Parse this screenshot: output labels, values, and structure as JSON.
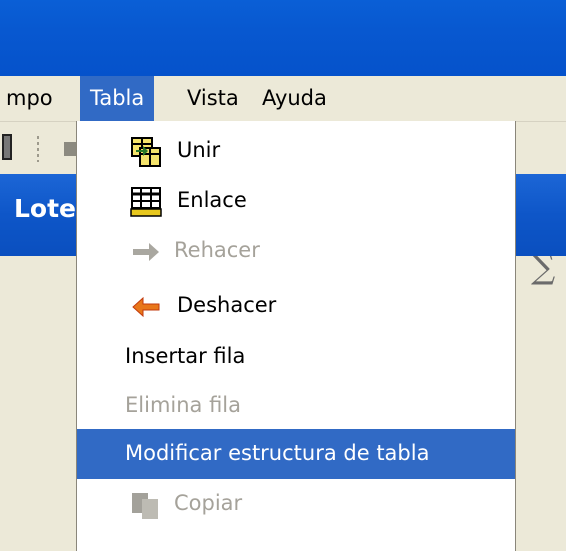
{
  "menubar": {
    "items": [
      {
        "label": "mpo"
      },
      {
        "label": "Tabla",
        "active": true
      },
      {
        "label": "Vista"
      },
      {
        "label": "Ayuda"
      }
    ]
  },
  "toolbar": {
    "sigma": "∑"
  },
  "panel": {
    "title": "Lote"
  },
  "menu": {
    "items": [
      {
        "label": "Unir",
        "icon": "merge-table-icon",
        "enabled": true
      },
      {
        "label": "Enlace",
        "icon": "link-table-icon",
        "enabled": true
      },
      {
        "label": "Rehacer",
        "icon": "redo-arrow-icon",
        "enabled": false
      },
      {
        "label": "Deshacer",
        "icon": "undo-arrow-icon",
        "enabled": true
      },
      {
        "label": "Insertar fila",
        "enabled": true
      },
      {
        "label": "Elimina fila",
        "enabled": false
      },
      {
        "label": "Modificar estructura de tabla",
        "enabled": true,
        "highlighted": true
      },
      {
        "label": "Copiar",
        "icon": "copy-icon",
        "enabled": false
      }
    ]
  },
  "colors": {
    "highlight": "#316ac5",
    "titlebar": "#0858d0",
    "menubar": "#ece9d8"
  }
}
